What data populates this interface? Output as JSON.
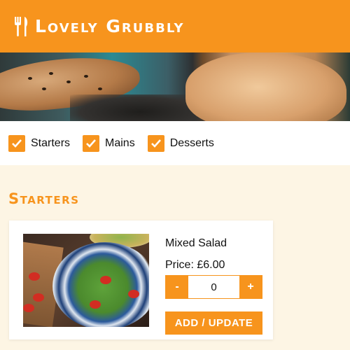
{
  "header": {
    "brand": "Lovely Grubbly",
    "logo_icon": "fork-knife-icon",
    "background_color": "#f7941d"
  },
  "filters": [
    {
      "label": "Starters",
      "checked": true
    },
    {
      "label": "Mains",
      "checked": true
    },
    {
      "label": "Desserts",
      "checked": true
    }
  ],
  "section": {
    "title": "Starters"
  },
  "item": {
    "name": "Mixed Salad",
    "price": "Price: £6.00",
    "quantity": "0",
    "decrement_label": "-",
    "increment_label": "+",
    "add_label": "ADD / UPDATE"
  },
  "colors": {
    "accent": "#f7941d",
    "page_background": "#fdf5e4"
  }
}
